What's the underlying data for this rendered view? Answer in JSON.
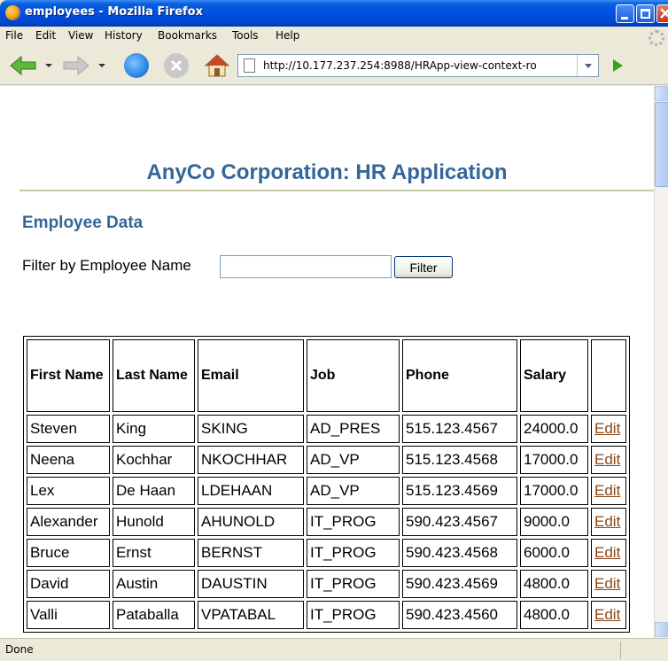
{
  "window": {
    "title": "employees - Mozilla Firefox"
  },
  "menu": [
    "File",
    "Edit",
    "View",
    "History",
    "Bookmarks",
    "Tools",
    "Help"
  ],
  "navbar": {
    "url": "http://10.177.237.254:8988/HRApp-view-context-ro"
  },
  "page": {
    "app_title": "AnyCo Corporation: HR Application",
    "section_title": "Employee Data",
    "filter_label": "Filter by Employee Name",
    "filter_value": "",
    "filter_button": "Filter"
  },
  "table": {
    "headers": [
      "First Name",
      "Last Name",
      "Email",
      "Job",
      "Phone",
      "Salary",
      ""
    ],
    "edit_label": "Edit",
    "rows": [
      [
        "Steven",
        "King",
        "SKING",
        "AD_PRES",
        "515.123.4567",
        "24000.0"
      ],
      [
        "Neena",
        "Kochhar",
        "NKOCHHAR",
        "AD_VP",
        "515.123.4568",
        "17000.0"
      ],
      [
        "Lex",
        "De Haan",
        "LDEHAAN",
        "AD_VP",
        "515.123.4569",
        "17000.0"
      ],
      [
        "Alexander",
        "Hunold",
        "AHUNOLD",
        "IT_PROG",
        "590.423.4567",
        "9000.0"
      ],
      [
        "Bruce",
        "Ernst",
        "BERNST",
        "IT_PROG",
        "590.423.4568",
        "6000.0"
      ],
      [
        "David",
        "Austin",
        "DAUSTIN",
        "IT_PROG",
        "590.423.4569",
        "4800.0"
      ],
      [
        "Valli",
        "Pataballa",
        "VPATABAL",
        "IT_PROG",
        "590.423.4560",
        "4800.0"
      ]
    ]
  },
  "status": {
    "text": "Done"
  },
  "colors": {
    "heading": "#336699",
    "edit_link": "#8B4513",
    "rule": "#C7C9A3"
  }
}
